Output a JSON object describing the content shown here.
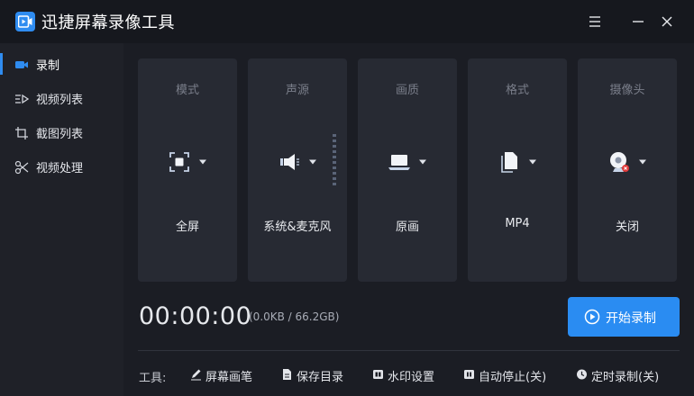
{
  "app": {
    "title": "迅捷屏幕录像工具"
  },
  "sidebar": {
    "items": [
      {
        "label": "录制",
        "icon": "video-camera-icon",
        "active": true
      },
      {
        "label": "视频列表",
        "icon": "video-list-icon",
        "active": false
      },
      {
        "label": "截图列表",
        "icon": "screenshot-list-icon",
        "active": false
      },
      {
        "label": "视频处理",
        "icon": "video-tools-icon",
        "active": false
      }
    ]
  },
  "cards": [
    {
      "title": "模式",
      "value": "全屏",
      "icon": "fullscreen-icon"
    },
    {
      "title": "声源",
      "value": "系统&麦克风",
      "icon": "speaker-icon"
    },
    {
      "title": "画质",
      "value": "原画",
      "icon": "laptop-icon"
    },
    {
      "title": "格式",
      "value": "MP4",
      "icon": "file-icon"
    },
    {
      "title": "摄像头",
      "value": "关闭",
      "icon": "webcam-icon"
    }
  ],
  "status": {
    "timer": "00:00:00",
    "size": "(0.0KB / 66.2GB)"
  },
  "record_button": {
    "label": "开始录制"
  },
  "toolbar": {
    "label": "工具:",
    "items": [
      {
        "label": "屏幕画笔",
        "icon": "pen-icon"
      },
      {
        "label": "保存目录",
        "icon": "folder-doc-icon"
      },
      {
        "label": "水印设置",
        "icon": "watermark-icon"
      },
      {
        "label": "自动停止(关)",
        "icon": "auto-stop-icon"
      },
      {
        "label": "定时录制(关)",
        "icon": "clock-icon"
      }
    ]
  },
  "colors": {
    "accent": "#2f8cf0",
    "background": "#1b1d24",
    "card": "#272a33",
    "sidebar": "#1f2128"
  }
}
